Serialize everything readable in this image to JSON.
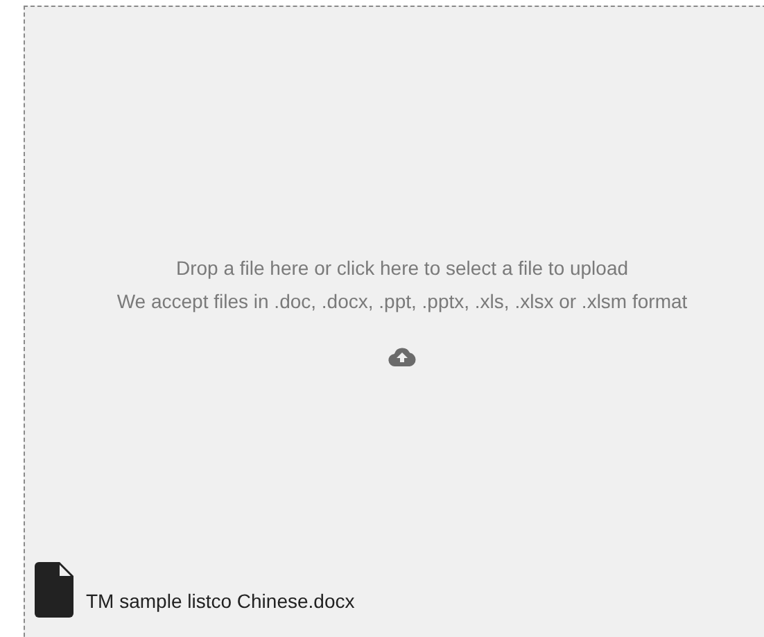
{
  "dropzone": {
    "instructions": [
      "Drop a file here or click here to select a file to upload",
      "We accept files in .doc, .docx, .ppt, .pptx, .xls, .xlsx or .xlsm format"
    ]
  },
  "files": [
    {
      "name": "TM sample listco Chinese.docx"
    }
  ]
}
